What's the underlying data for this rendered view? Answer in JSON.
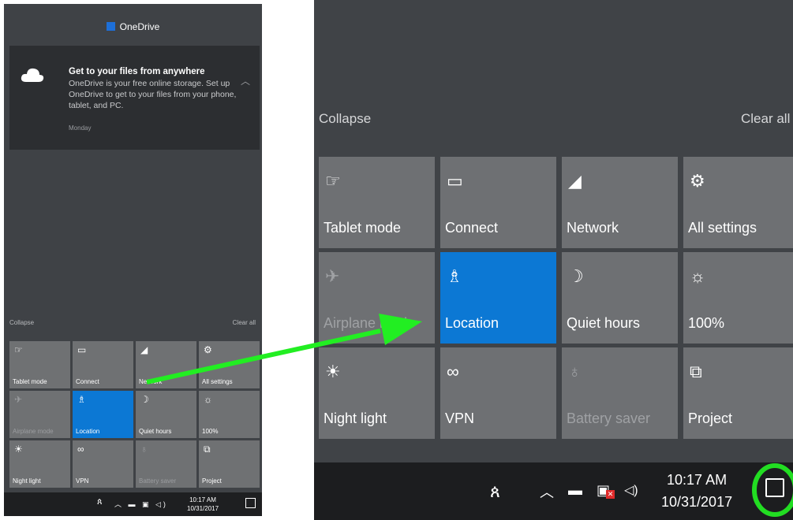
{
  "left": {
    "onedrive_header": "OneDrive",
    "notification": {
      "title": "Get to your files from anywhere",
      "body": "OneDrive is your free online storage. Set up OneDrive to get to your files from your phone, tablet, and PC.",
      "time": "Monday",
      "icon": "cloud-icon"
    },
    "collapse": "Collapse",
    "clear_all": "Clear all",
    "tiles": [
      {
        "label": "Tablet mode",
        "icon": "☞"
      },
      {
        "label": "Connect",
        "icon": "▭"
      },
      {
        "label": "Network",
        "icon": "◢"
      },
      {
        "label": "All settings",
        "icon": "⚙"
      },
      {
        "label": "Airplane mode",
        "icon": "✈"
      },
      {
        "label": "Location",
        "icon": "♗"
      },
      {
        "label": "Quiet hours",
        "icon": "☽"
      },
      {
        "label": "100%",
        "icon": "☼"
      },
      {
        "label": "Night light",
        "icon": "☀"
      },
      {
        "label": "VPN",
        "icon": "∞"
      },
      {
        "label": "Battery saver",
        "icon": "♁"
      },
      {
        "label": "Project",
        "icon": "⧉"
      }
    ],
    "taskbar": {
      "time": "10:17 AM",
      "date": "10/31/2017"
    }
  },
  "right": {
    "collapse": "Collapse",
    "clear_all": "Clear all",
    "tiles": [
      {
        "label": "Tablet mode",
        "icon": "☞"
      },
      {
        "label": "Connect",
        "icon": "▭"
      },
      {
        "label": "Network",
        "icon": "◢"
      },
      {
        "label": "All settings",
        "icon": "⚙"
      },
      {
        "label": "Airplane mode",
        "icon": "✈"
      },
      {
        "label": "Location",
        "icon": "♗"
      },
      {
        "label": "Quiet hours",
        "icon": "☽"
      },
      {
        "label": "100%",
        "icon": "☼"
      },
      {
        "label": "Night light",
        "icon": "☀"
      },
      {
        "label": "VPN",
        "icon": "∞"
      },
      {
        "label": "Battery saver",
        "icon": "♁"
      },
      {
        "label": "Project",
        "icon": "⧉"
      }
    ],
    "taskbar": {
      "time": "10:17 AM",
      "date": "10/31/2017",
      "people_icon": "people-icon"
    }
  },
  "colors": {
    "active_tile": "#0c78d4",
    "arrow": "#22ee22",
    "highlight_circle": "#22dd22"
  }
}
